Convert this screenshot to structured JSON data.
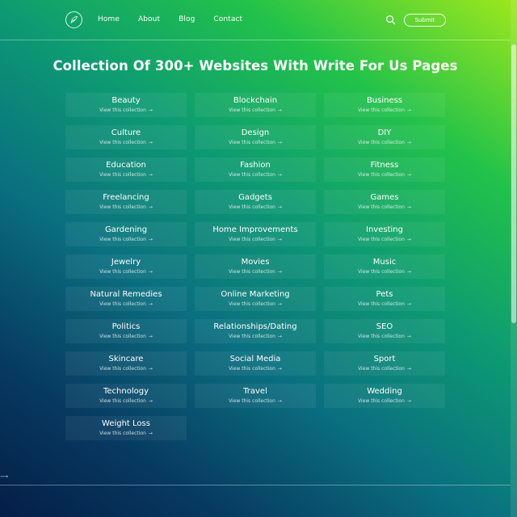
{
  "nav": {
    "items": [
      {
        "label": "Home"
      },
      {
        "label": "About"
      },
      {
        "label": "Blog"
      },
      {
        "label": "Contact"
      }
    ],
    "submit_label": "Submit"
  },
  "page": {
    "title": "Collection Of 300+ Websites With Write For Us Pages",
    "link_text": "View this collection"
  },
  "collections": [
    {
      "label": "Beauty",
      "link": "View this collection"
    },
    {
      "label": "Blockchain",
      "link": "View this collection"
    },
    {
      "label": "Business",
      "link": "View this collection"
    },
    {
      "label": "Culture",
      "link": "View this collection"
    },
    {
      "label": "Design",
      "link": "View this collection"
    },
    {
      "label": "DIY",
      "link": "View this collection"
    },
    {
      "label": "Education",
      "link": "View this collection"
    },
    {
      "label": "Fashion",
      "link": "View this collection"
    },
    {
      "label": "Fitness",
      "link": "View this collection"
    },
    {
      "label": "Freelancing",
      "link": "View this collection"
    },
    {
      "label": "Gadgets",
      "link": "View this collection"
    },
    {
      "label": "Games",
      "link": "View this collection"
    },
    {
      "label": "Gardening",
      "link": "View this collection"
    },
    {
      "label": "Home Improvements",
      "link": "View this collection"
    },
    {
      "label": "Investing",
      "link": "View this collection"
    },
    {
      "label": "Jewelry",
      "link": "View this collection"
    },
    {
      "label": "Movies",
      "link": "View this collection"
    },
    {
      "label": "Music",
      "link": "View this collection"
    },
    {
      "label": "Natural Remedies",
      "link": "View this collection"
    },
    {
      "label": "Online Marketing",
      "link": "View this collection"
    },
    {
      "label": "Pets",
      "link": "View this collection"
    },
    {
      "label": "Politics",
      "link": "View this collection"
    },
    {
      "label": "Relationships/Dating",
      "link": "View this collection"
    },
    {
      "label": "SEO",
      "link": "View this collection"
    },
    {
      "label": "Skincare",
      "link": "View this collection"
    },
    {
      "label": "Social Media",
      "link": "View this collection"
    },
    {
      "label": "Sport",
      "link": "View this collection"
    },
    {
      "label": "Technology",
      "link": "View this collection"
    },
    {
      "label": "Travel",
      "link": "View this collection"
    },
    {
      "label": "Wedding",
      "link": "View this collection"
    },
    {
      "label": "Weight Loss",
      "link": "View this collection"
    }
  ],
  "icons": {
    "logo": "feather-logo-icon",
    "search": "search-icon",
    "card_arrow": "arrow-right-icon",
    "side_arrow": "long-arrow-right-icon"
  },
  "colors": {
    "gradient_top_right": "#9ee81c",
    "gradient_mid": "#0d9a73",
    "gradient_bottom_left": "#041e48"
  }
}
